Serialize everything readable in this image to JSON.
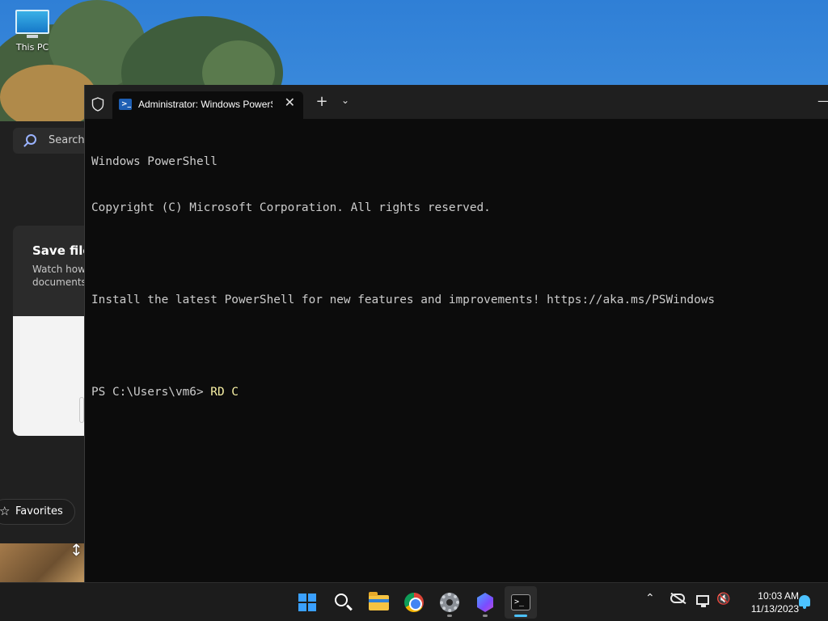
{
  "desktop": {
    "icons": [
      {
        "label": "This PC",
        "icon": "this-pc-icon"
      }
    ]
  },
  "background_window": {
    "search_label": "Search",
    "card_title": "Save file",
    "card_description": "Watch how\ndocuments.",
    "favorites_label": "Favorites"
  },
  "terminal": {
    "tab_title": "Administrator: Windows PowerShell",
    "new_tab_label": "+",
    "close_tab_label": "✕",
    "dropdown_label": "⌄",
    "minimize_label": "—",
    "lines": [
      "Windows PowerShell",
      "Copyright (C) Microsoft Corporation. All rights reserved.",
      "",
      "Install the latest PowerShell for new features and improvements! https://aka.ms/PSWindows",
      ""
    ],
    "prompt": "PS C:\\Users\\vm6> ",
    "command": "RD C"
  },
  "taskbar": {
    "apps": [
      {
        "name": "start",
        "icon": "windows-logo-icon",
        "running": false,
        "active": false
      },
      {
        "name": "search",
        "icon": "search-icon",
        "running": false,
        "active": false
      },
      {
        "name": "file-explorer",
        "icon": "folder-icon",
        "running": false,
        "active": false
      },
      {
        "name": "chrome",
        "icon": "chrome-icon",
        "running": false,
        "active": false
      },
      {
        "name": "settings",
        "icon": "settings-gear-icon",
        "running": true,
        "active": false
      },
      {
        "name": "copilot",
        "icon": "copilot-icon",
        "running": true,
        "active": false
      },
      {
        "name": "terminal",
        "icon": "terminal-icon",
        "running": true,
        "active": true
      }
    ],
    "tray_chevron": "⌃",
    "volume_glyph": "🔇",
    "time": "10:03 AM",
    "date": "11/13/2023",
    "accent": "#4cc2ff"
  }
}
